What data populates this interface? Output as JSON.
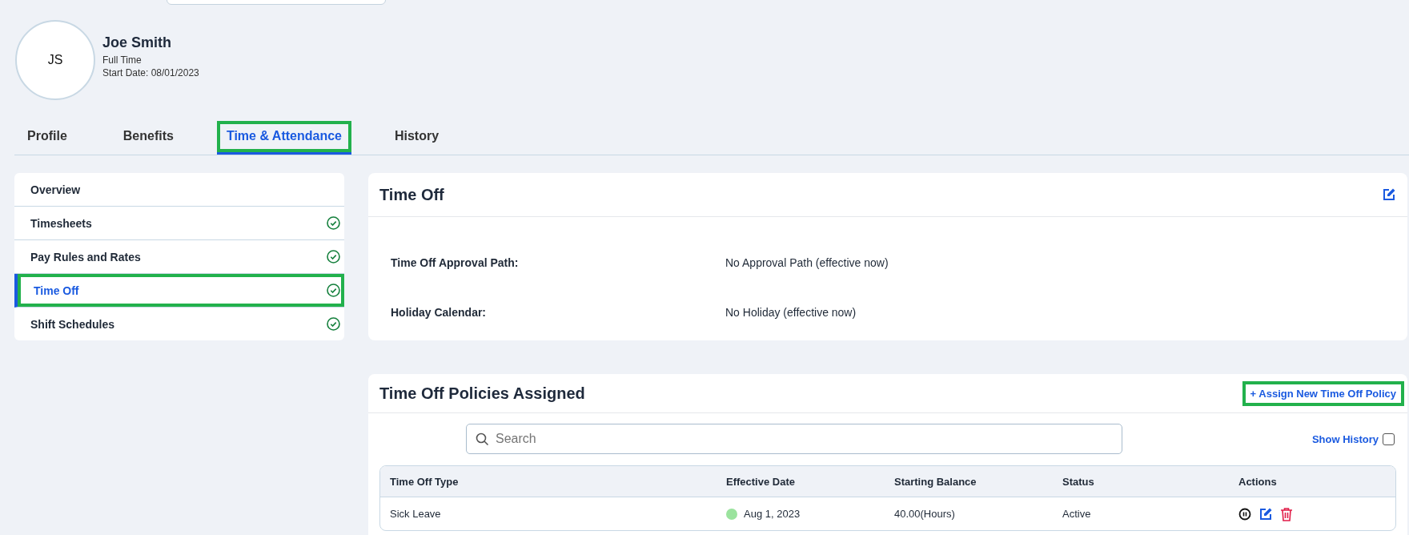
{
  "top_search": {
    "visible": true
  },
  "profile": {
    "initials": "JS",
    "name": "Joe Smith",
    "employment": "Full Time",
    "start_date": "Start Date: 08/01/2023"
  },
  "tabs": [
    {
      "label": "Profile",
      "selected": false,
      "highlighted": false
    },
    {
      "label": "Benefits",
      "selected": false,
      "highlighted": false
    },
    {
      "label": "Time & Attendance",
      "selected": true,
      "highlighted": true
    },
    {
      "label": "History",
      "selected": false,
      "highlighted": false
    }
  ],
  "sidebar": {
    "items": [
      {
        "label": "Overview",
        "selected": false,
        "complete": false,
        "highlighted": false
      },
      {
        "label": "Timesheets",
        "selected": false,
        "complete": true,
        "highlighted": false
      },
      {
        "label": "Pay Rules and Rates",
        "selected": false,
        "complete": true,
        "highlighted": false
      },
      {
        "label": "Time Off",
        "selected": true,
        "complete": true,
        "highlighted": true
      },
      {
        "label": "Shift Schedules",
        "selected": false,
        "complete": true,
        "highlighted": false
      }
    ]
  },
  "time_off": {
    "title": "Time Off",
    "fields": [
      {
        "label": "Time Off Approval Path:",
        "value": "No Approval Path (effective now)"
      },
      {
        "label": "Holiday Calendar:",
        "value": "No Holiday (effective now)"
      }
    ]
  },
  "policies": {
    "title": "Time Off Policies Assigned",
    "assign_button": {
      "label": "+ Assign New Time Off Policy",
      "highlighted": true
    },
    "search": {
      "placeholder": "Search"
    },
    "show_history": {
      "label": "Show History",
      "checked": false
    },
    "table": {
      "columns": [
        "Time Off Type",
        "Effective Date",
        "Starting Balance",
        "Status",
        "Actions"
      ],
      "rows": [
        {
          "type": "Sick Leave",
          "effective_date": "Aug 1, 2023",
          "color": "#9be39e",
          "starting_balance": "40.00(Hours)",
          "status": "Active"
        }
      ]
    }
  }
}
